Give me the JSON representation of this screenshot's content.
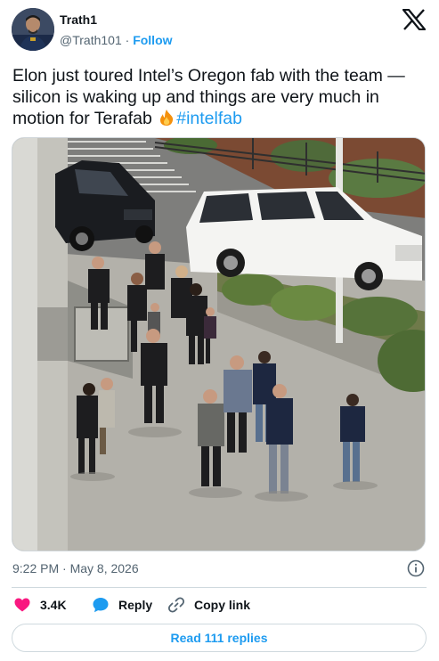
{
  "author": {
    "name": "Trath1",
    "handle": "@Trath101",
    "separator": "·",
    "follow_label": "Follow"
  },
  "tweet": {
    "text_line": "Elon just toured Intel’s Oregon fab with the team — silicon is waking up and things are very much in motion for Terafab ",
    "hashtag": "#intelfab",
    "emoji": "fire-emoji",
    "media_alt": "photo-of-group-walking-outside-intel-fab"
  },
  "meta": {
    "timestamp": "9:22 PM · May 8, 2026"
  },
  "actions": {
    "like_count": "3.4K",
    "reply_label": "Reply",
    "copy_label": "Copy link"
  },
  "replies_button": "Read 111 replies",
  "colors": {
    "accent": "#1d9bf0",
    "like_red": "#f91880",
    "text": "#0f1419",
    "muted": "#536471",
    "border": "#cfd9de"
  },
  "icons": [
    "x-logo-icon",
    "info-icon",
    "heart-icon",
    "reply-bubble-icon",
    "link-icon"
  ]
}
